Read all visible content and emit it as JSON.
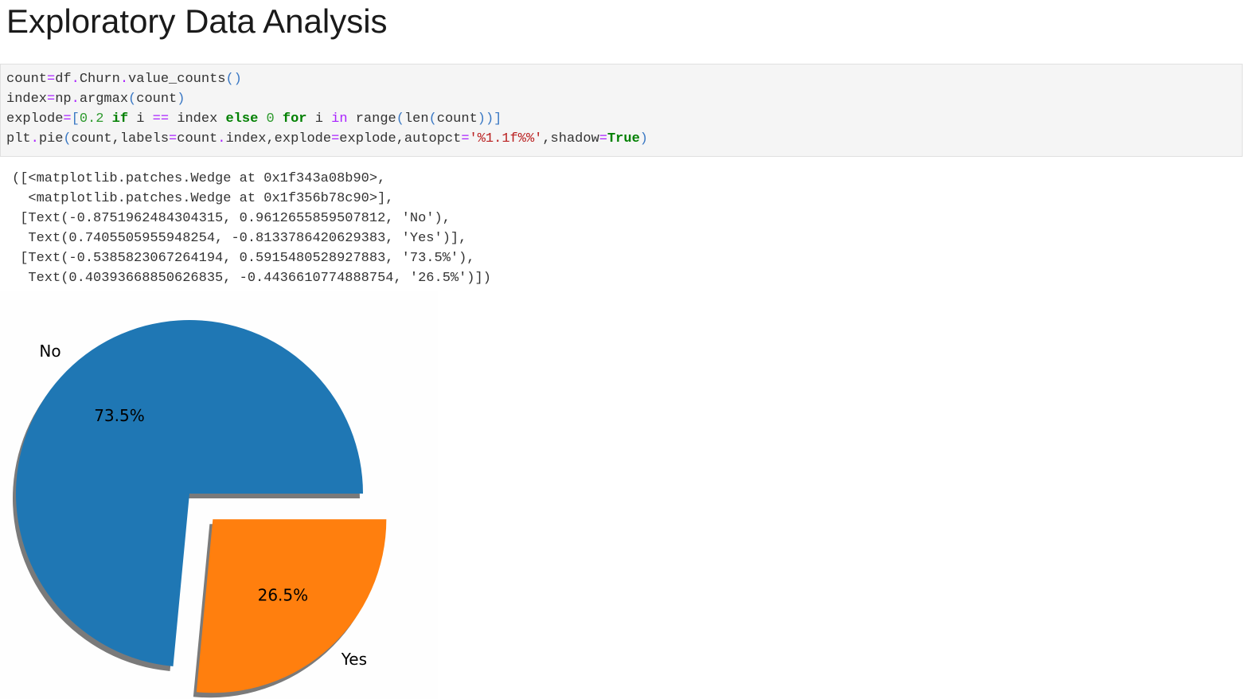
{
  "heading": "Exploratory Data Analysis",
  "code_cell": {
    "lines": [
      [
        {
          "t": "count",
          "c": ""
        },
        {
          "t": "=",
          "c": "op"
        },
        {
          "t": "df",
          "c": ""
        },
        {
          "t": ".",
          "c": "op"
        },
        {
          "t": "Churn",
          "c": ""
        },
        {
          "t": ".",
          "c": "op"
        },
        {
          "t": "value_counts",
          "c": ""
        },
        {
          "t": "()",
          "c": "paren"
        }
      ],
      [
        {
          "t": "index",
          "c": ""
        },
        {
          "t": "=",
          "c": "op"
        },
        {
          "t": "np",
          "c": ""
        },
        {
          "t": ".",
          "c": "op"
        },
        {
          "t": "argmax",
          "c": ""
        },
        {
          "t": "(",
          "c": "paren"
        },
        {
          "t": "count",
          "c": ""
        },
        {
          "t": ")",
          "c": "paren"
        }
      ],
      [
        {
          "t": "explode",
          "c": ""
        },
        {
          "t": "=",
          "c": "op"
        },
        {
          "t": "[",
          "c": "paren"
        },
        {
          "t": "0.2",
          "c": "num"
        },
        {
          "t": " ",
          "c": ""
        },
        {
          "t": "if",
          "c": "kw"
        },
        {
          "t": " i ",
          "c": ""
        },
        {
          "t": "==",
          "c": "op"
        },
        {
          "t": " index ",
          "c": ""
        },
        {
          "t": "else",
          "c": "kw"
        },
        {
          "t": " ",
          "c": ""
        },
        {
          "t": "0",
          "c": "num"
        },
        {
          "t": " ",
          "c": ""
        },
        {
          "t": "for",
          "c": "kw"
        },
        {
          "t": " i ",
          "c": ""
        },
        {
          "t": "in",
          "c": "op"
        },
        {
          "t": " range",
          "c": ""
        },
        {
          "t": "(",
          "c": "paren"
        },
        {
          "t": "len",
          "c": ""
        },
        {
          "t": "(",
          "c": "paren"
        },
        {
          "t": "count",
          "c": ""
        },
        {
          "t": "))]",
          "c": "paren"
        }
      ],
      [
        {
          "t": "plt",
          "c": ""
        },
        {
          "t": ".",
          "c": "op"
        },
        {
          "t": "pie",
          "c": ""
        },
        {
          "t": "(",
          "c": "paren"
        },
        {
          "t": "count,labels",
          "c": ""
        },
        {
          "t": "=",
          "c": "op"
        },
        {
          "t": "count",
          "c": ""
        },
        {
          "t": ".",
          "c": "op"
        },
        {
          "t": "index,explode",
          "c": ""
        },
        {
          "t": "=",
          "c": "op"
        },
        {
          "t": "explode,autopct",
          "c": ""
        },
        {
          "t": "=",
          "c": "op"
        },
        {
          "t": "'%1.1f%%'",
          "c": "str"
        },
        {
          "t": ",shadow",
          "c": ""
        },
        {
          "t": "=",
          "c": "op"
        },
        {
          "t": "True",
          "c": "kw"
        },
        {
          "t": ")",
          "c": "paren"
        }
      ]
    ]
  },
  "output": {
    "lines": [
      "([<matplotlib.patches.Wedge at 0x1f343a08b90>,",
      "  <matplotlib.patches.Wedge at 0x1f356b78c90>],",
      " [Text(-0.8751962484304315, 0.9612655859507812, 'No'),",
      "  Text(0.7405505955948254, -0.8133786420629383, 'Yes')],",
      " [Text(-0.5385823067264194, 0.5915480528927883, '73.5%'),",
      "  Text(0.40393668850626835, -0.4436610774888754, '26.5%')])"
    ]
  },
  "chart_data": {
    "type": "pie",
    "labels": [
      "No",
      "Yes"
    ],
    "values": [
      73.5,
      26.5
    ],
    "pct_labels": [
      "73.5%",
      "26.5%"
    ],
    "explode": [
      0,
      0.2
    ],
    "colors": [
      "#1f77b4",
      "#ff7f0e"
    ],
    "shadow": true,
    "startangle": 0
  }
}
